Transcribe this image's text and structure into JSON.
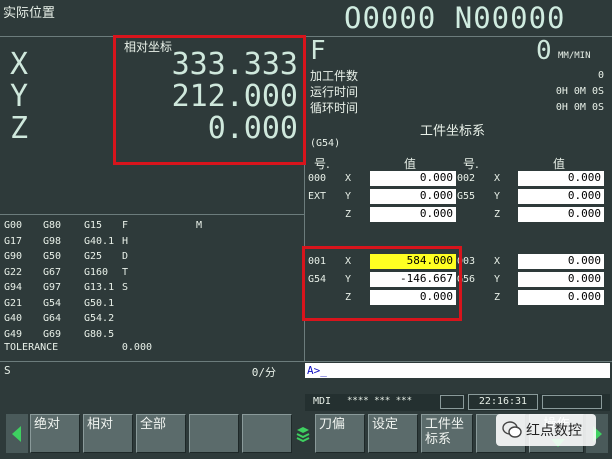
{
  "header": {
    "title": "实际位置",
    "program": "O0000 N00000"
  },
  "relative": {
    "label": "相对坐标",
    "axes": [
      "X",
      "Y",
      "Z"
    ],
    "values": [
      "333.333",
      "212.000",
      "0.000"
    ]
  },
  "feed": {
    "label": "F",
    "value": "0",
    "unit": "MM/MIN"
  },
  "counters": [
    {
      "label": "加工件数",
      "value": "0"
    },
    {
      "label": "运行时间",
      "value": "0H 0M 0S"
    },
    {
      "label": "循环时间",
      "value": "0H 0M 0S"
    }
  ],
  "work": {
    "title": "工件坐标系",
    "subtitle": "(G54)",
    "col_no": "号.",
    "col_val": "值",
    "left": [
      {
        "n1": "000",
        "n2": "EXT",
        "x": "0.000",
        "y": "0.000",
        "z": "0.000"
      },
      {
        "n1": "001",
        "n2": "G54",
        "x": "584.000",
        "y": "-146.667",
        "z": "0.000"
      }
    ],
    "right": [
      {
        "n1": "002",
        "n2": "G55",
        "x": "0.000",
        "y": "0.000",
        "z": "0.000"
      },
      {
        "n1": "003",
        "n2": "G56",
        "x": "0.000",
        "y": "0.000",
        "z": "0.000"
      }
    ],
    "axis_x": "X",
    "axis_y": "Y",
    "axis_z": "Z"
  },
  "modal": {
    "rows": [
      [
        "G00",
        "G80",
        "G15",
        "F",
        "M"
      ],
      [
        "G17",
        "G98",
        "G40.1",
        "H",
        ""
      ],
      [
        "G90",
        "G50",
        "G25",
        "D",
        ""
      ],
      [
        "G22",
        "G67",
        "G160",
        "T",
        ""
      ],
      [
        "G94",
        "G97",
        "G13.1",
        "S",
        ""
      ],
      [
        "G21",
        "G54",
        "G50.1",
        "",
        ""
      ],
      [
        "G40",
        "G64",
        "G54.2",
        "",
        ""
      ],
      [
        "G49",
        "G69",
        "G80.5",
        "",
        ""
      ]
    ],
    "tolerance_label": "TOLERANCE",
    "tolerance_value": "0.000"
  },
  "status": {
    "s_label": "S",
    "s_value": "0/分",
    "input": "A>_"
  },
  "mode": {
    "mdi": "MDI",
    "stars": "**** *** ***",
    "time": "22:16:31"
  },
  "softkeys": {
    "abs": "绝对",
    "rel": "相对",
    "all": "全部",
    "offset": "刀偏",
    "setting": "设定",
    "work": "工件坐标系",
    "op": "操作"
  },
  "watermark": "红点数控",
  "colors": {
    "screen_bg": "#2e3a3a",
    "highlight": "#ffff22",
    "annotation": "#d8141c"
  }
}
